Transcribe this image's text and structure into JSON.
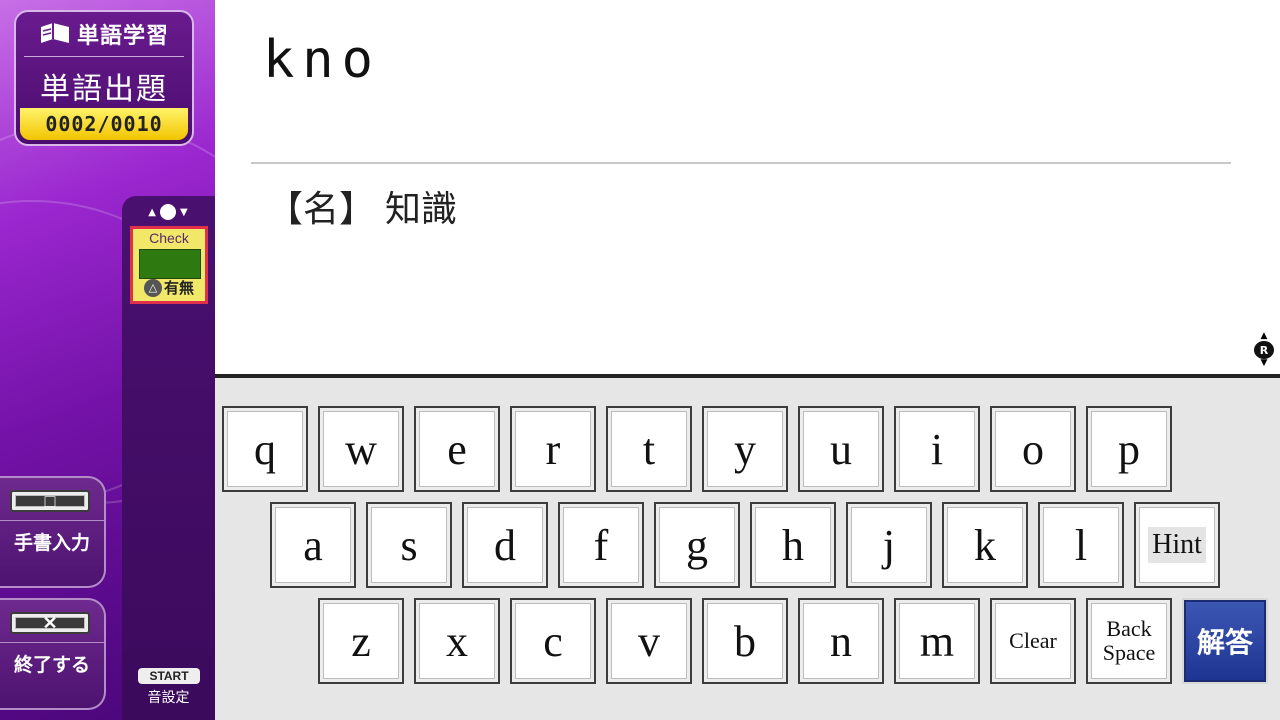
{
  "sidebar": {
    "app_title": "単語学習",
    "mode": "単語出題",
    "counter": "0002/0010",
    "check": {
      "label": "Check",
      "toggle_label": "有無",
      "toggle_button_symbol": "△",
      "lamp_color": "#2f7a10"
    },
    "start_label": "START",
    "sound_setting_label": "音設定",
    "handwriting_button": {
      "key_symbol": "□",
      "label": "手書入力"
    },
    "quit_button": {
      "key_symbol": "✕",
      "label": "終了する"
    }
  },
  "main": {
    "answer_input": "kno",
    "meaning": {
      "part_of_speech": "【名】",
      "definition": "知識"
    },
    "scroll_icon_letter": "R"
  },
  "keyboard": {
    "row1": [
      "q",
      "w",
      "e",
      "r",
      "t",
      "y",
      "u",
      "i",
      "o",
      "p"
    ],
    "row2": [
      "a",
      "s",
      "d",
      "f",
      "g",
      "h",
      "j",
      "k",
      "l"
    ],
    "row3": [
      "z",
      "x",
      "c",
      "v",
      "b",
      "n",
      "m"
    ],
    "hint_label": "Hint",
    "clear_label": "Clear",
    "backspace_label": "Back\nSpace",
    "answer_label": "解答",
    "answer_color": "#1d3590"
  }
}
